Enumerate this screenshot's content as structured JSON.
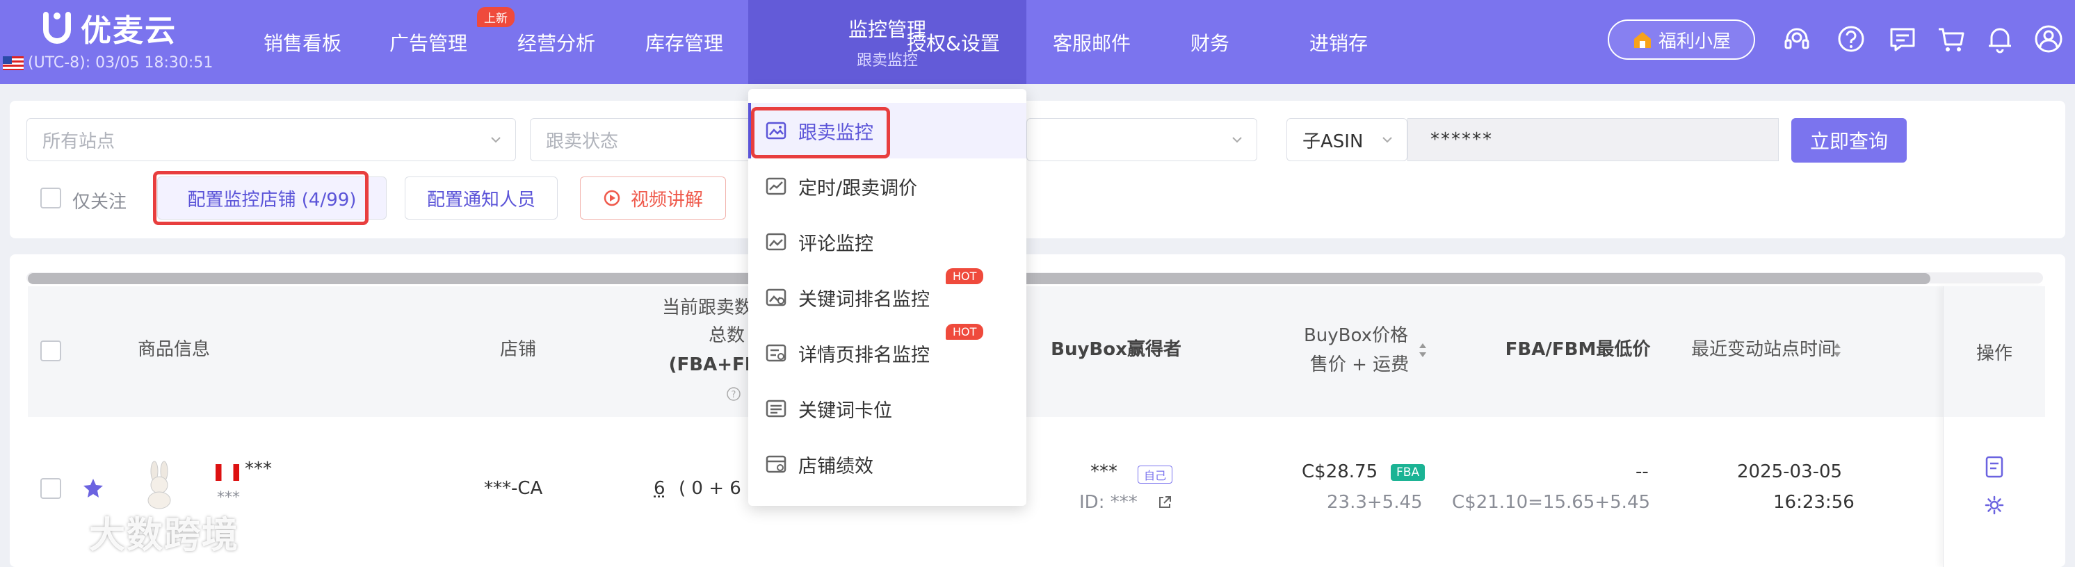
{
  "app": {
    "name": "优麦云",
    "timezone": "(UTC-8): 03/05 18:30:51"
  },
  "nav": {
    "items": [
      {
        "label": "销售看板"
      },
      {
        "label": "广告管理",
        "badge": "上新"
      },
      {
        "label": "经营分析"
      },
      {
        "label": "库存管理"
      },
      {
        "label": "监控管理",
        "sub": "跟卖监控",
        "active": true
      },
      {
        "label": "授权&设置"
      },
      {
        "label": "客服邮件"
      },
      {
        "label": "财务"
      },
      {
        "label": "进销存"
      }
    ],
    "fuli": "福利小屋",
    "icons": [
      "headset-icon",
      "help-icon",
      "message-icon",
      "cart-icon",
      "bell-icon",
      "user-icon"
    ]
  },
  "filters": {
    "site_placeholder": "所有站点",
    "status_placeholder": "跟卖状态",
    "asin_type": "子ASIN",
    "asin_value": "******",
    "query_label": "立即查询",
    "only_follow_label": "仅关注",
    "config_store_label": "配置监控店铺 (4/99)",
    "config_notify_label": "配置通知人员",
    "video_label": "视频讲解"
  },
  "table": {
    "headers": {
      "product": "商品信息",
      "store": "店铺",
      "count_line1": "当前跟卖数量",
      "count_line2": "总数",
      "count_line3": "(FBA+FBM)",
      "buybox_winner": "BuyBox赢得者",
      "buybox_price_line1": "BuyBox价格",
      "buybox_price_line2": "售价 + 运费",
      "fba_fbm_min": "FBA/FBM最低价",
      "last_change": "最近变动站点时间",
      "ops": "操作"
    },
    "rows": [
      {
        "asin": "***",
        "sub": "***",
        "store": "***-CA",
        "count_total": "6",
        "count_breakdown": "( 0 + 6",
        "winner": "***",
        "winner_tag": "自己",
        "winner_id": "ID: ***",
        "price": "C$28.75",
        "price_tag": "FBA",
        "price_breakdown": "23.3+5.45",
        "min_price": "--",
        "min_breakdown": "C$21.10=15.65+5.45",
        "date": "2025-03-05",
        "time": "16:23:56"
      }
    ]
  },
  "dropdown": {
    "items": [
      {
        "label": "跟卖监控",
        "active": true
      },
      {
        "label": "定时/跟卖调价"
      },
      {
        "label": "评论监控"
      },
      {
        "label": "关键词排名监控",
        "hot": "HOT"
      },
      {
        "label": "详情页排名监控",
        "hot": "HOT"
      },
      {
        "label": "关键词卡位"
      },
      {
        "label": "店铺绩效"
      }
    ]
  },
  "watermark": "大数跨境",
  "colors": {
    "brand": "#7b74ee",
    "brand_dark": "#635bd8",
    "highlight": "#e83e3e",
    "hot": "#ef4a3c",
    "fba": "#1bb394"
  }
}
